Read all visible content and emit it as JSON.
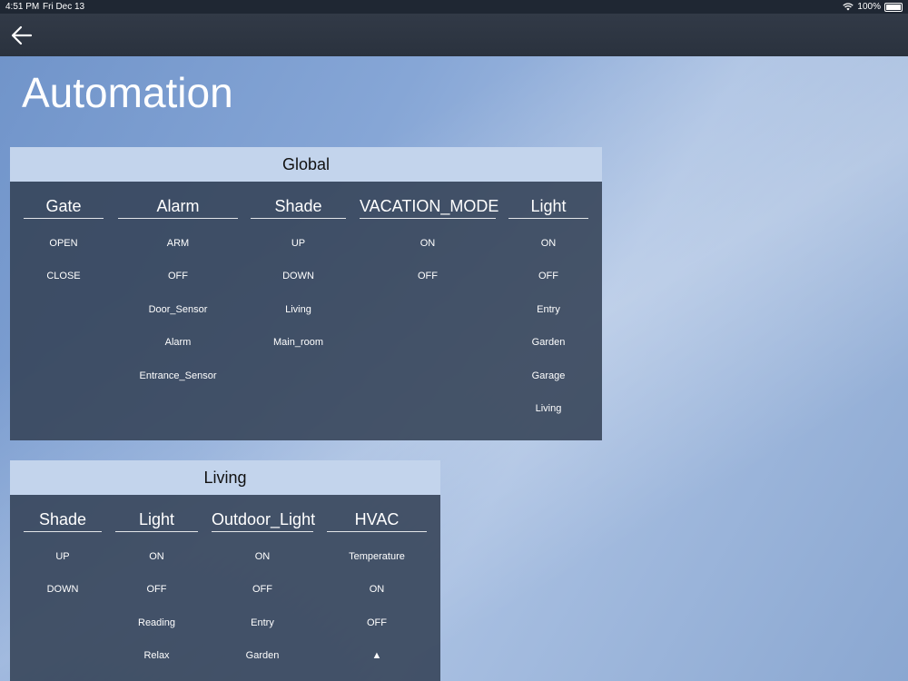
{
  "status": {
    "time": "4:51 PM",
    "date": "Fri Dec 13",
    "battery": "100%"
  },
  "page": {
    "title": "Automation"
  },
  "sections": [
    {
      "name": "Global",
      "columns": [
        {
          "title": "Gate",
          "items": [
            "OPEN",
            "CLOSE"
          ]
        },
        {
          "title": "Alarm",
          "items": [
            "ARM",
            "OFF",
            "Door_Sensor",
            "Alarm",
            "Entrance_Sensor"
          ]
        },
        {
          "title": "Shade",
          "items": [
            "UP",
            "DOWN",
            "Living",
            "Main_room"
          ]
        },
        {
          "title": "VACATION_MODE",
          "items": [
            "ON",
            "OFF"
          ]
        },
        {
          "title": "Light",
          "items": [
            "ON",
            "OFF",
            "Entry",
            "Garden",
            "Garage",
            "Living"
          ]
        }
      ]
    },
    {
      "name": "Living",
      "columns": [
        {
          "title": "Shade",
          "items": [
            "UP",
            "DOWN"
          ]
        },
        {
          "title": "Light",
          "items": [
            "ON",
            "OFF",
            "Reading",
            "Relax"
          ]
        },
        {
          "title": "Outdoor_Light",
          "items": [
            "ON",
            "OFF",
            "Entry",
            "Garden"
          ]
        },
        {
          "title": "HVAC",
          "items": [
            "Temperature",
            "ON",
            "OFF",
            "▲"
          ]
        }
      ]
    }
  ]
}
